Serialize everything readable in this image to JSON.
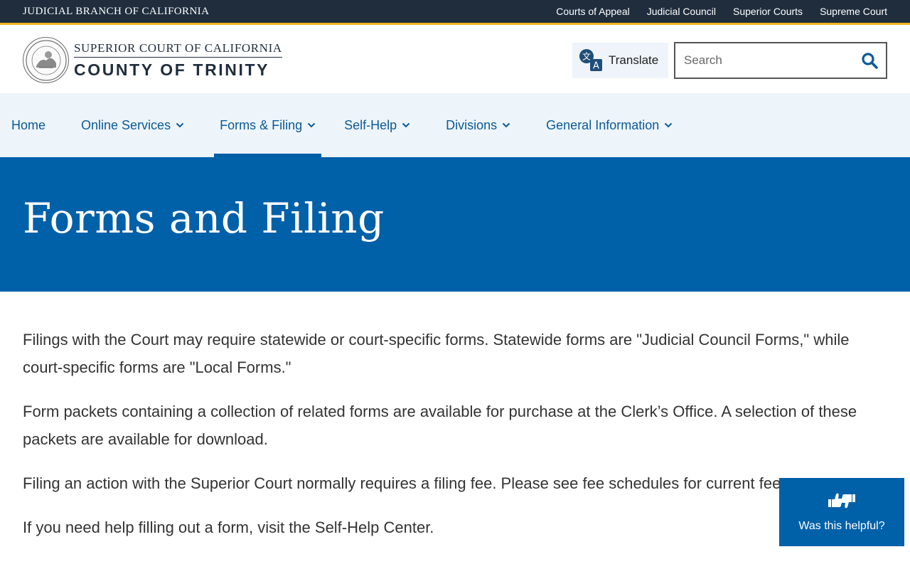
{
  "topbar": {
    "brand": "JUDICIAL BRANCH OF CALIFORNIA",
    "links": [
      "Courts of Appeal",
      "Judicial Council",
      "Superior Courts",
      "Supreme Court"
    ]
  },
  "header": {
    "logo_line1": "SUPERIOR COURT OF CALIFORNIA",
    "logo_line2": "COUNTY OF TRINITY",
    "translate_label": "Translate",
    "search_placeholder": "Search"
  },
  "nav": {
    "items": [
      {
        "label": "Home"
      },
      {
        "label": "Online Services"
      },
      {
        "label": "Forms & Filing"
      },
      {
        "label": "Self-Help"
      },
      {
        "label": "Divisions"
      },
      {
        "label": "General Information"
      }
    ]
  },
  "hero": {
    "title": "Forms and Filing"
  },
  "content": {
    "paragraphs": [
      "Filings with the Court may require statewide or court-specific forms. Statewide forms are \"Judicial Council Forms,\" while court-specific forms are \"Local Forms.\"",
      "Form packets containing a collection of related forms are available for purchase at the Clerk’s Office. A selection of these packets are available for download.",
      "Filing an action with the Superior Court normally requires a filing fee. Please see fee schedules for current fees.",
      "If you need help filling out a form, visit the Self-Help Center."
    ]
  },
  "feedback": {
    "label": "Was this helpful?"
  },
  "colors": {
    "topbar_bg": "#1f2d3d",
    "accent_gold": "#f0b323",
    "nav_bg": "#edf4fa",
    "nav_text": "#0b5a98",
    "hero_bg": "#0060a8"
  },
  "icons": [
    "seal-logo",
    "translate-icon",
    "search-icon",
    "chevron-down-icon",
    "thumbs-up-down-icon"
  ]
}
